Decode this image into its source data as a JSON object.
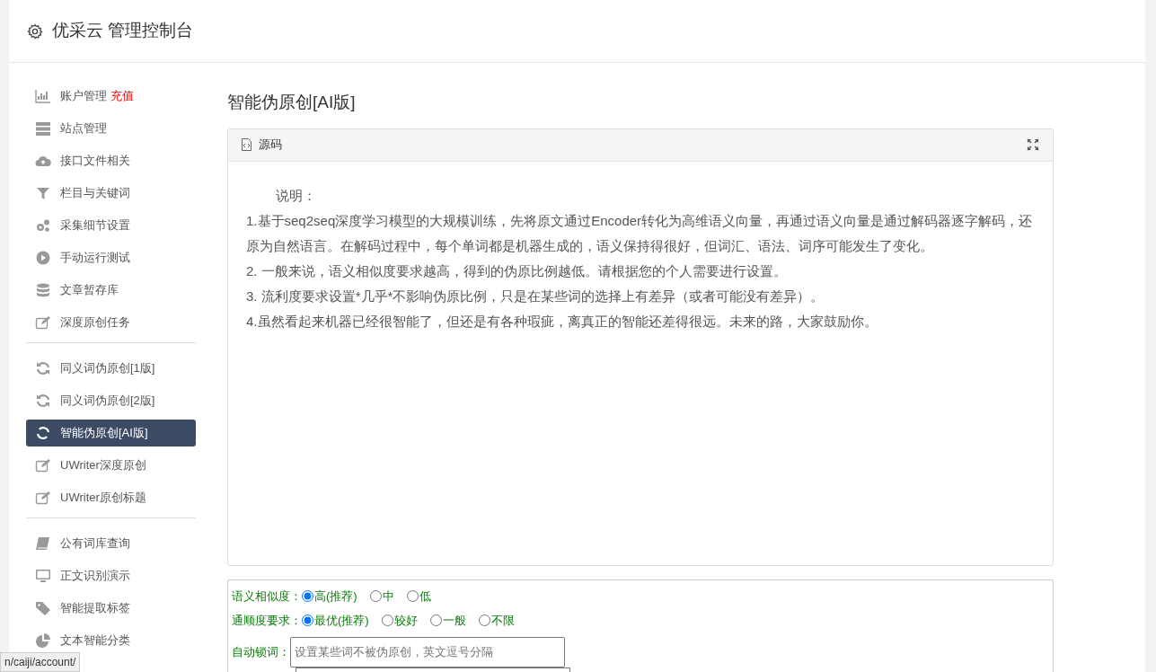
{
  "header": {
    "title": "优采云 管理控制台"
  },
  "sidebar": {
    "groups": [
      [
        {
          "label": "账户管理",
          "badge": "充值",
          "selected": false
        },
        {
          "label": "站点管理",
          "selected": false
        },
        {
          "label": "接口文件相关",
          "selected": false
        },
        {
          "label": "栏目与关键词",
          "selected": false
        },
        {
          "label": "采集细节设置",
          "selected": false
        },
        {
          "label": "手动运行测试",
          "selected": false
        },
        {
          "label": "文章暂存库",
          "selected": false
        },
        {
          "label": "深度原创任务",
          "selected": false
        }
      ],
      [
        {
          "label": "同义词伪原创[1版]",
          "selected": false
        },
        {
          "label": "同义词伪原创[2版]",
          "selected": false
        },
        {
          "label": "智能伪原创[AI版]",
          "selected": true
        },
        {
          "label": "UWriter深度原创",
          "selected": false
        },
        {
          "label": "UWriter原创标题",
          "selected": false
        }
      ],
      [
        {
          "label": "公有词库查询",
          "selected": false
        },
        {
          "label": "正文识别演示",
          "selected": false
        },
        {
          "label": "智能提取标签",
          "selected": false
        },
        {
          "label": "文本智能分类",
          "selected": false
        }
      ]
    ]
  },
  "main": {
    "title": "智能伪原创[AI版]",
    "editor": {
      "toolbar_label": "源码",
      "lines": [
        "说明：",
        "1.基于seq2seq深度学习模型的大规模训练，先将原文通过Encoder转化为高维语义向量，再通过语义向量是通过解码器逐字解码，还原为自然语言。在解码过程中，每个单词都是机器生成的，语义保持得很好，但词汇、语法、词序可能发生了变化。",
        "2. 一般来说，语义相似度要求越高，得到的伪原比例越低。请根据您的个人需要进行设置。",
        "3. 流利度要求设置*几乎*不影响伪原比例，只是在某些词的选择上有差异（或者可能没有差异）。",
        "4.虽然看起来机器已经很智能了，但还是有各种瑕疵，离真正的智能还差得很远。未来的路，大家鼓励你。"
      ]
    },
    "form": {
      "radio_groups": [
        {
          "label": "语义相似度：",
          "options": [
            {
              "label": "高(推荐)",
              "selected": true
            },
            {
              "label": "中",
              "selected": false
            },
            {
              "label": "低",
              "selected": false
            }
          ]
        },
        {
          "label": "通顺度要求：",
          "options": [
            {
              "label": "最优(推荐)",
              "selected": true
            },
            {
              "label": "较好",
              "selected": false
            },
            {
              "label": "一般",
              "selected": false
            },
            {
              "label": "不限",
              "selected": false
            }
          ]
        }
      ],
      "lock_words": {
        "label": "自动锁词：",
        "placeholder": "设置某些词不被伪原创，英文逗号分隔"
      }
    }
  },
  "status_bar": {
    "url": "n/caiji/account/"
  }
}
